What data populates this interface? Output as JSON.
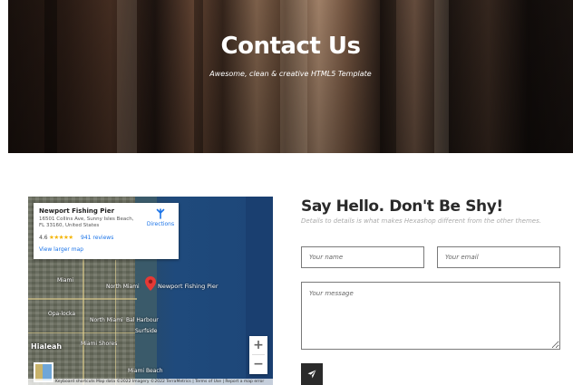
{
  "hero": {
    "title": "Contact Us",
    "subtitle": "Awesome, clean & creative HTML5 Template"
  },
  "map": {
    "place_name": "Newport Fishing Pier",
    "address": "16501 Collins Ave, Sunny Isles Beach, FL 33160, United States",
    "rating": "4.6",
    "stars_icon": "five-star-rating",
    "reviews": "941 reviews",
    "directions_label": "Directions",
    "view_larger": "View larger map",
    "pin_label": "Newport Fishing Pier",
    "zoom_in": "+",
    "zoom_out": "−",
    "footer": "Keyboard shortcuts   Map data ©2022 Imagery ©2022 TerraMetrics | Terms of Use | Report a map error",
    "places": {
      "miami": "Miami",
      "north_miami": "North Miami",
      "opa_locka": "Opa-locka",
      "north_miami_2": "North Miami",
      "bal_harbour": "Bal Harbour",
      "surfside": "Surfside",
      "hialeah": "Hialeah",
      "miami_shores": "Miami Shores",
      "miami_beach": "Miami Beach"
    }
  },
  "form": {
    "title": "Say Hello. Don't Be Shy!",
    "subtitle": "Details to details is what makes Hexashop different from the other themes.",
    "name_placeholder": "Your name",
    "email_placeholder": "Your email",
    "message_placeholder": "Your message",
    "send_icon": "paper-plane-icon"
  },
  "colors": {
    "dark": "#2a2a2a",
    "link": "#1a73e8",
    "pin": "#e53935",
    "star": "#f4b400"
  }
}
